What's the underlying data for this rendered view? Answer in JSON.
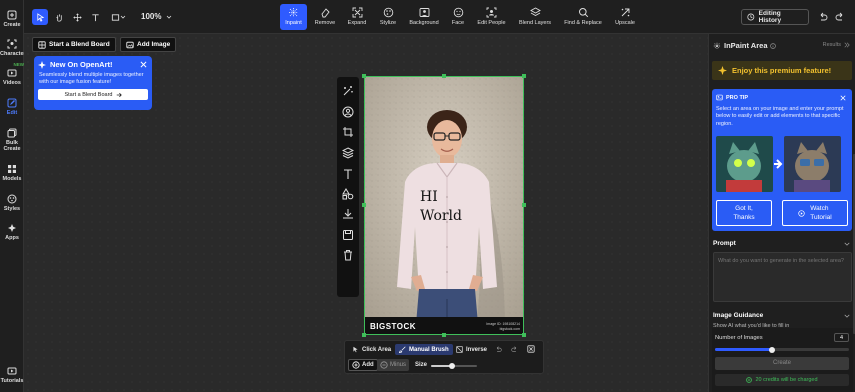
{
  "rail": [
    {
      "label": "Create",
      "icon": "plus-square-icon"
    },
    {
      "label": "Character",
      "icon": "character-icon"
    },
    {
      "label": "Videos",
      "icon": "video-icon",
      "badge": "NEW"
    },
    {
      "label": "Edit",
      "icon": "edit-icon",
      "active": true
    },
    {
      "label": "Bulk Create",
      "icon": "bulk-icon"
    },
    {
      "label": "Models",
      "icon": "models-icon"
    },
    {
      "label": "Styles",
      "icon": "styles-icon"
    },
    {
      "label": "Apps",
      "icon": "apps-icon"
    },
    {
      "label": "Tutorials",
      "icon": "tutorials-icon"
    }
  ],
  "topbar": {
    "zoom": "100%",
    "tools": [
      {
        "label": "Inpaint",
        "active": true
      },
      {
        "label": "Remove"
      },
      {
        "label": "Expand"
      },
      {
        "label": "Stylize"
      },
      {
        "label": "Background"
      },
      {
        "label": "Face"
      },
      {
        "label": "Edit People"
      },
      {
        "label": "Blend Layers"
      },
      {
        "label": "Find & Replace"
      },
      {
        "label": "Upscale"
      }
    ],
    "history_label": "Editing History"
  },
  "canvas": {
    "blend_button": "Start a Blend Board",
    "add_image_button": "Add Image",
    "popover": {
      "title": "New On OpenArt!",
      "body": "Seamlessly blend multiple images together with our image fusion feature!",
      "cta": "Start a Blend Board"
    },
    "photo_text_1": "HI",
    "photo_text_2": "World",
    "watermark": "BIGSTOCK",
    "image_id": "Image ID: 198108214",
    "image_site": "bigstock.com"
  },
  "bottom_tools": {
    "click_area": "Click Area",
    "manual_brush": "Manual Brush",
    "inverse": "Inverse",
    "add": "Add",
    "minus": "Minus",
    "size": "Size",
    "size_value": 0.45
  },
  "panel": {
    "title": "InPaint Area",
    "results": "Results",
    "premium": "Enjoy this premium feature!",
    "tip_title": "PRO TIP",
    "tip_body": "Select an area on your image and enter your prompt below to easily edit or add elements to that specific region.",
    "got_it": "Got It,\nThanks",
    "watch": "Watch\nTutorial",
    "prompt_title": "Prompt",
    "prompt_placeholder": "What do you want to generate in the selected area?",
    "guidance_title": "Image Guidance",
    "guidance_sub": "Show AI what you'd like to fill in",
    "num_images_label": "Number of Images",
    "num_images": "4",
    "create": "Create",
    "credits": "20 credits will be charged"
  },
  "colors": {
    "accent": "#2f5bff",
    "select": "#3fbf5a",
    "premium": "#f2c12e"
  }
}
